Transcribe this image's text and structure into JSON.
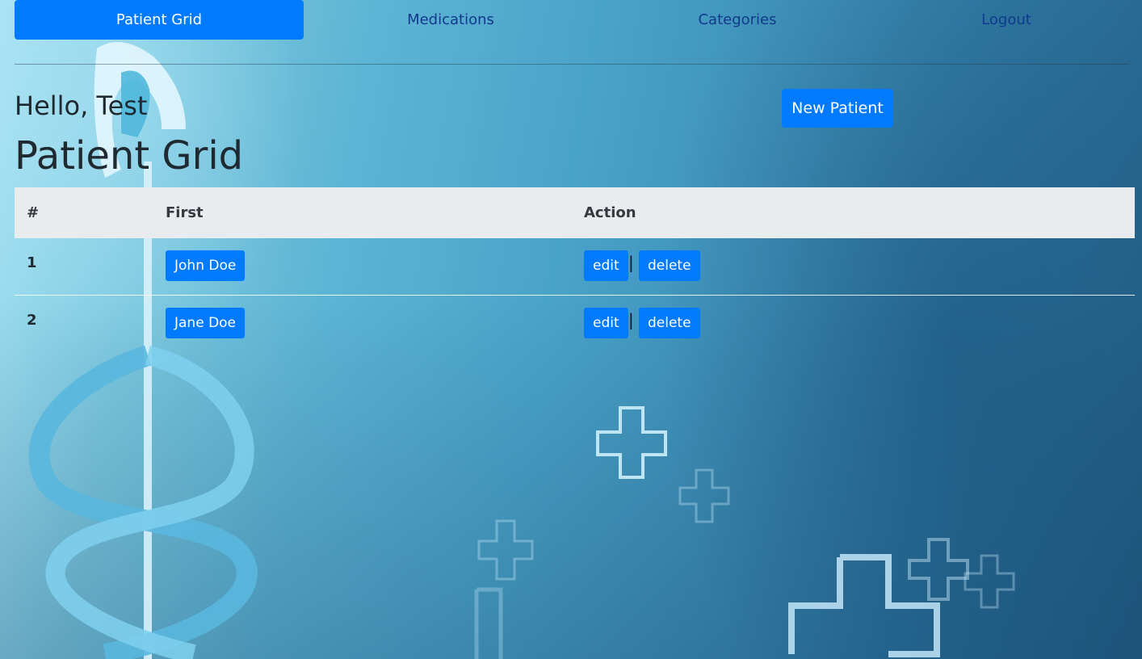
{
  "nav": {
    "items": [
      {
        "label": "Patient Grid",
        "active": true
      },
      {
        "label": "Medications",
        "active": false
      },
      {
        "label": "Categories",
        "active": false
      },
      {
        "label": "Logout",
        "active": false
      }
    ]
  },
  "greeting": "Hello, Test",
  "page_title": "Patient Grid",
  "new_patient_label": "New Patient",
  "table": {
    "headers": [
      "#",
      "First",
      "Action"
    ],
    "rows": [
      {
        "num": "1",
        "name": "John Doe",
        "edit": "edit",
        "separator": "|",
        "delete": "delete"
      },
      {
        "num": "2",
        "name": "Jane Doe",
        "edit": "edit",
        "separator": "|",
        "delete": "delete"
      }
    ]
  },
  "colors": {
    "accent": "#007bff",
    "nav_text": "#123a8c",
    "header_bg": "#e9ecef"
  },
  "background": {
    "icons": [
      "caduceus-icon",
      "medical-cross-icon"
    ]
  }
}
